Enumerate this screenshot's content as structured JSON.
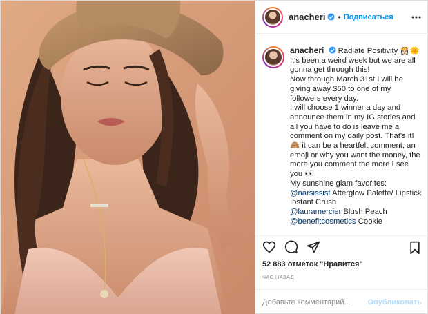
{
  "post": {
    "username": "anacheri",
    "follow_label": "Подписаться",
    "separator": "•",
    "caption_inline": "Radiate Positivity 👸🏻🌞",
    "caption_lines": [
      "It's been a weird week but we are all gonna get through this!",
      "",
      "Now through March 31st I will be giving away $50 to one of my followers every day.",
      "I will choose 1 winner a day and announce them in my IG stories and all you have to do is leave me a comment on my daily post. That's it!",
      "🙈 it can be a heartfelt comment, an emoji or why you want the money, the more you comment the more I see you 👀",
      "My sunshine glam favorites:"
    ],
    "mentions": [
      {
        "handle": "@narsissist",
        "text": " Afterglow Palette/ Lipstick Instant Crush"
      },
      {
        "handle": "@lauramercier",
        "text": " Blush Peach"
      },
      {
        "handle": "@benefitcosmetics",
        "text": " Cookie"
      }
    ],
    "likes_text": "52 883 отметок \"Нравится\"",
    "time_ago": "ЧАС НАЗАД",
    "comment_placeholder": "Добавьте комментарий...",
    "publish_label": "Опубликовать"
  },
  "icons": {
    "like": "heart-icon",
    "comment": "comment-icon",
    "share": "share-icon",
    "save": "bookmark-icon",
    "more": "more-icon",
    "verified": "verified-badge-icon"
  },
  "colors": {
    "link": "#0095f6",
    "mention": "#00376b",
    "muted": "#8e8e8e",
    "publish_disabled": "#b2dffc",
    "verified": "#3897f0"
  }
}
